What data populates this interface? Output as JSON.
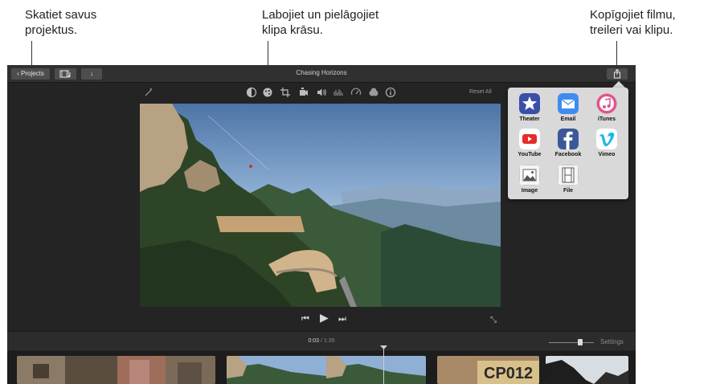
{
  "callouts": {
    "left": [
      "Skatiet savus",
      "projektus."
    ],
    "middle": [
      "Labojiet un pielāgojiet",
      "klipa krāsu."
    ],
    "right": [
      "Kopīgojiet filmu,",
      "treileri vai klipu."
    ]
  },
  "window": {
    "title": "Chasing Horizons",
    "projects_button": "Projects"
  },
  "toolbar": {
    "tools": [
      "magic-wand-icon",
      "color-balance-icon",
      "color-correction-icon",
      "crop-icon",
      "stabilization-icon",
      "volume-icon",
      "noise-reduction-icon",
      "speed-icon",
      "filter-icon",
      "info-icon"
    ],
    "reset_label": "Reset All"
  },
  "timeline": {
    "current_time": "0:03",
    "separator": "/",
    "total_time": "1:35",
    "settings_label": "Settings",
    "zoom_level": 0.7
  },
  "share": {
    "items": [
      {
        "label": "Theater",
        "icon": "theater-icon",
        "color": "#3b4fa8"
      },
      {
        "label": "Email",
        "icon": "email-icon",
        "color": "#3f8cf0"
      },
      {
        "label": "iTunes",
        "icon": "itunes-icon",
        "color": "#e0568c"
      },
      {
        "label": "YouTube",
        "icon": "youtube-icon",
        "color": "#e52d27"
      },
      {
        "label": "Facebook",
        "icon": "facebook-icon",
        "color": "#3b5998"
      },
      {
        "label": "Vimeo",
        "icon": "vimeo-icon",
        "color": "#1ab7ea"
      },
      {
        "label": "Image",
        "icon": "image-icon",
        "color": "#f5f5f5"
      },
      {
        "label": "File",
        "icon": "file-icon",
        "color": "#f5f5f5"
      }
    ]
  },
  "filmstrip": {
    "clip_caption": "CP012"
  }
}
